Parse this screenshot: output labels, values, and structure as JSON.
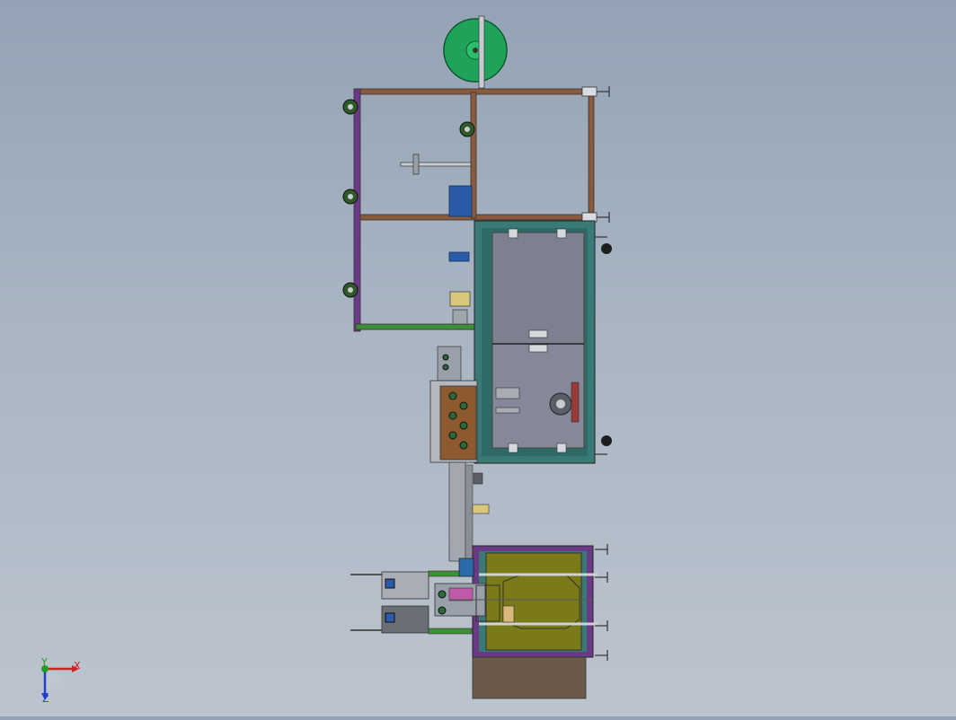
{
  "viewport": {
    "background_top": "#93a3b5",
    "background_bottom": "#bcc4ce"
  },
  "colors": {
    "spool_green": "#1fa35a",
    "frame_purple": "#6a3a86",
    "frame_brown": "#8a5a3c",
    "frame_teal": "#2f7a76",
    "frame_green": "#3f8f3a",
    "panel_gray": "#7c8090",
    "olive": "#7a7a18",
    "copper": "#8c5a2e",
    "base_brown": "#6b5a4a",
    "caster_black": "#1e1e1e",
    "blue_block": "#2b5aa8"
  },
  "triad": {
    "x_label": "X",
    "y_label": "Y",
    "z_label": "Z",
    "x_color": "#d02020",
    "y_color": "#20a020",
    "z_color": "#2040d0"
  }
}
